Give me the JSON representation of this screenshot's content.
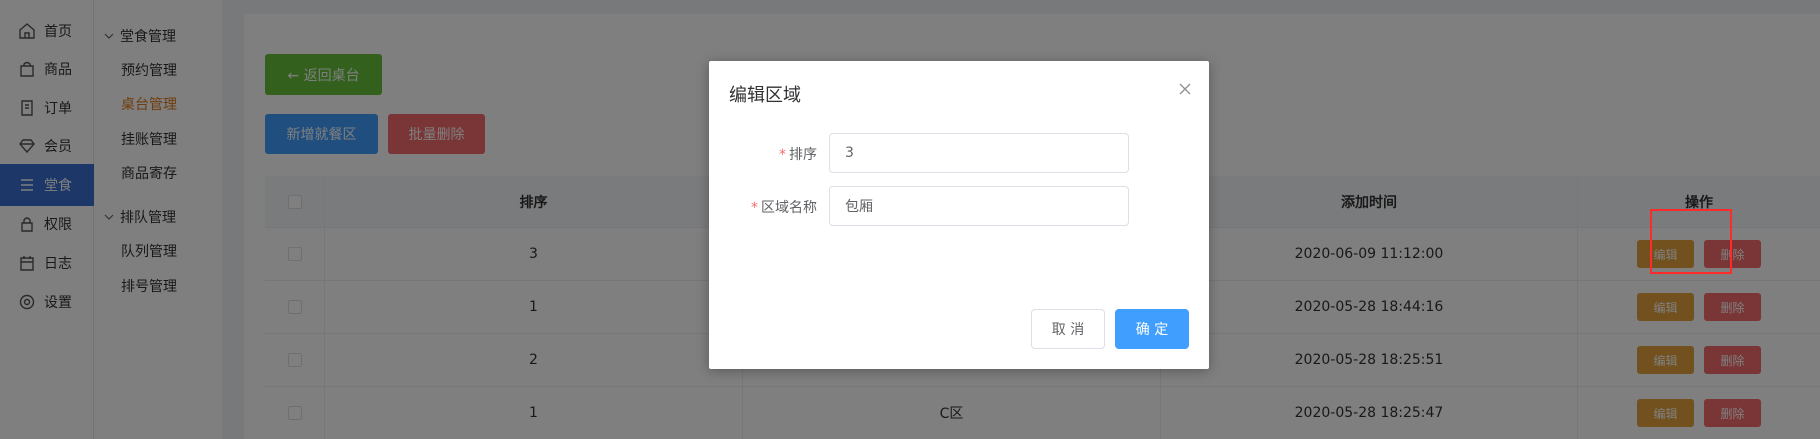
{
  "nav": {
    "items": [
      {
        "label": "首页",
        "icon": "home-icon"
      },
      {
        "label": "商品",
        "icon": "bag-icon"
      },
      {
        "label": "订单",
        "icon": "order-icon"
      },
      {
        "label": "会员",
        "icon": "member-icon"
      },
      {
        "label": "堂食",
        "icon": "dine-icon"
      },
      {
        "label": "权限",
        "icon": "lock-icon"
      },
      {
        "label": "日志",
        "icon": "calendar-icon"
      },
      {
        "label": "设置",
        "icon": "gear-icon"
      }
    ],
    "active_label": "堂食"
  },
  "submenu": {
    "group1": {
      "title": "堂食管理",
      "items": [
        "预约管理",
        "桌台管理",
        "挂账管理",
        "商品寄存"
      ]
    },
    "group2": {
      "title": "排队管理",
      "items": [
        "队列管理",
        "排号管理"
      ]
    },
    "active_item": "桌台管理"
  },
  "toolbar": {
    "back_label": "← 返回桌台",
    "add_label": "新增就餐区",
    "batch_delete_label": "批量删除"
  },
  "table": {
    "headers": {
      "sort": "排序",
      "time": "添加时间",
      "ops": "操作"
    },
    "rows": [
      {
        "sort": "3",
        "name": "",
        "time": "2020-06-09 11:12:00"
      },
      {
        "sort": "1",
        "name": "",
        "time": "2020-05-28 18:44:16"
      },
      {
        "sort": "2",
        "name": "",
        "time": "2020-05-28 18:25:51"
      },
      {
        "sort": "1",
        "name": "C区",
        "time": "2020-05-28 18:25:47"
      }
    ],
    "edit_label": "编辑",
    "delete_label": "删除"
  },
  "dialog": {
    "title": "编辑区域",
    "sort_label": "排序",
    "sort_value": "3",
    "name_label": "区域名称",
    "name_value": "包厢",
    "required_mark": "*",
    "cancel_label": "取 消",
    "ok_label": "确 定"
  },
  "colors": {
    "primary": "#409eff",
    "success": "#67c23a",
    "danger": "#f56c6c",
    "warning": "#e6a23c",
    "active_nav": "#3a6fd0",
    "active_submenu": "#e07a1f",
    "highlight": "#ff2a2a"
  }
}
